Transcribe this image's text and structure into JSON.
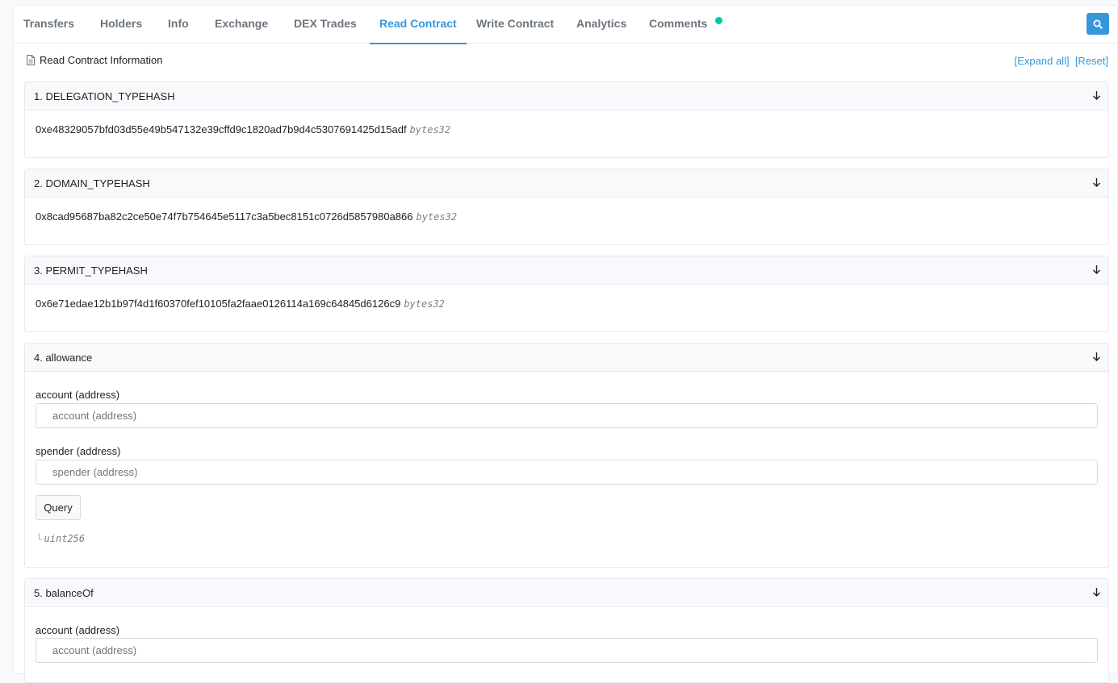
{
  "tabs": {
    "transfers": "Transfers",
    "holders": "Holders",
    "info": "Info",
    "exchange": "Exchange",
    "dex_trades": "DEX Trades",
    "read_contract": "Read Contract",
    "write_contract": "Write Contract",
    "analytics": "Analytics",
    "comments": "Comments",
    "active": "Read Contract"
  },
  "header": {
    "title": "Read Contract Information",
    "expand_all": "[Expand all]",
    "reset": "[Reset]"
  },
  "functions": [
    {
      "title": "1. DELEGATION_TYPEHASH",
      "value": "0xe48329057bfd03d55e49b547132e39cffd9c1820ad7b9d4c5307691425d15adf",
      "type": "bytes32"
    },
    {
      "title": "2. DOMAIN_TYPEHASH",
      "value": "0x8cad95687ba82c2ce50e74f7b754645e5117c3a5bec8151c0726d5857980a866",
      "type": "bytes32"
    },
    {
      "title": "3. PERMIT_TYPEHASH",
      "value": "0x6e71edae12b1b97f4d1f60370fef10105fa2faae0126114a169c64845d6126c9",
      "type": "bytes32"
    },
    {
      "title": "4. allowance",
      "inputs": [
        {
          "label": "account (address)",
          "placeholder": "account (address)"
        },
        {
          "label": "spender (address)",
          "placeholder": "spender (address)"
        }
      ],
      "button": "Query",
      "return_prefix": "└",
      "return_type": "uint256"
    },
    {
      "title": "5. balanceOf",
      "inputs": [
        {
          "label": "account (address)",
          "placeholder": "account (address)"
        }
      ]
    }
  ],
  "colors": {
    "accent": "#3498db",
    "dot": "#00c9a7"
  }
}
